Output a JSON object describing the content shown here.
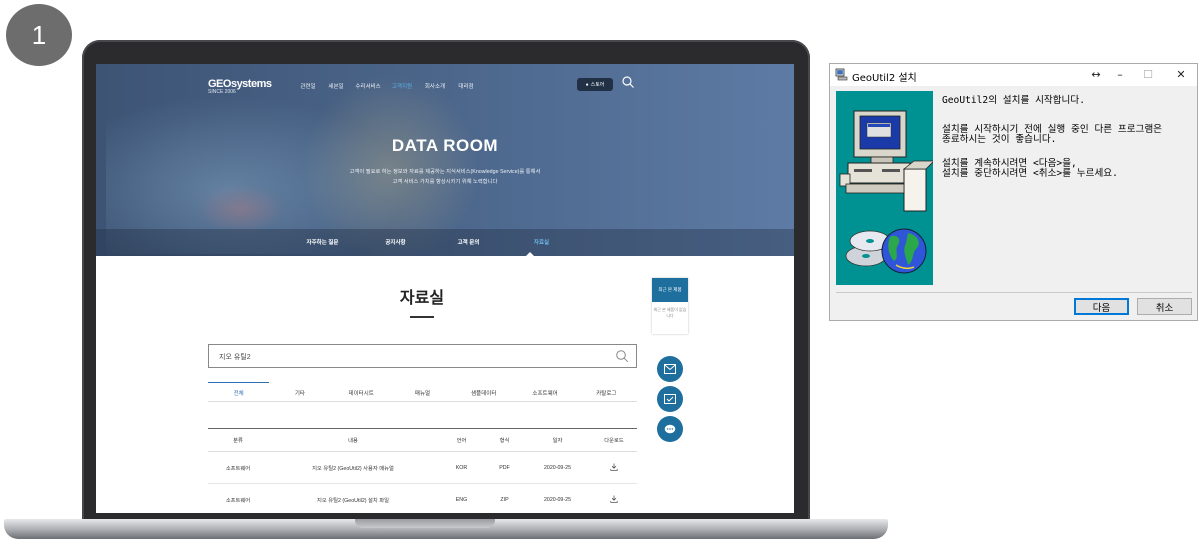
{
  "step_number": "1",
  "website": {
    "logo": "GEOsystems",
    "logo_tagline": "SINCE 2006",
    "nav": [
      "관련일",
      "세븐일",
      "수리서비스",
      "고객지원",
      "회사소개",
      "대리점"
    ],
    "store_button": "스토어",
    "hero_title": "DATA ROOM",
    "hero_desc_line1": "고객이 필요로 하는 정보와 자료를 제공하는 지식서비스(Knowledge Service)를 통해서",
    "hero_desc_line2": "고객 서비스 가치를 향상시키기 위해 노력합니다",
    "subnav": [
      "자주하는 질문",
      "공지사항",
      "고객 문의",
      "자료실"
    ],
    "page_title": "자료실",
    "search_value": "지오 유틸2",
    "tabs": [
      "전체",
      "기타",
      "데이터시트",
      "매뉴얼",
      "샘플데이터",
      "소프트웨어",
      "카탈로그"
    ],
    "table": {
      "headers": [
        "분류",
        "내용",
        "언어",
        "형식",
        "일자",
        "다운로드"
      ],
      "rows": [
        [
          "소프트웨어",
          "지오 유틸2 (GeoUtil2) 사용자 매뉴얼",
          "KOR",
          "PDF",
          "2020-09-25"
        ],
        [
          "소프트웨어",
          "지오 유틸2 (GeoUtil2) 설치 파일",
          "ENG",
          "ZIP",
          "2020-09-25"
        ]
      ]
    },
    "recent_title": "최근 본 제품",
    "recent_empty": "최근 본 제품이 없습니다",
    "colors": {
      "accent": "#1e6e9e",
      "hero": "#4a6488",
      "active_tab": "#2b6fb5"
    }
  },
  "installer": {
    "title": "GeoUtil2 설치",
    "controls": [
      "↔",
      "–",
      "☐",
      "✕"
    ],
    "line1": "GeoUtil2의 설치를 시작합니다.",
    "line2a": "설치를 시작하시기 전에 실행 중인 다른 프로그램은",
    "line2b": "종료하시는 것이 좋습니다.",
    "line3a": "설치를 계속하시려면 <다음>을,",
    "line3b": "설치를 중단하시려면 <취소>를 누르세요.",
    "next_button": "다음",
    "cancel_button": "취소",
    "colors": {
      "art_background": "#009292",
      "focus": "#0078d7"
    }
  }
}
